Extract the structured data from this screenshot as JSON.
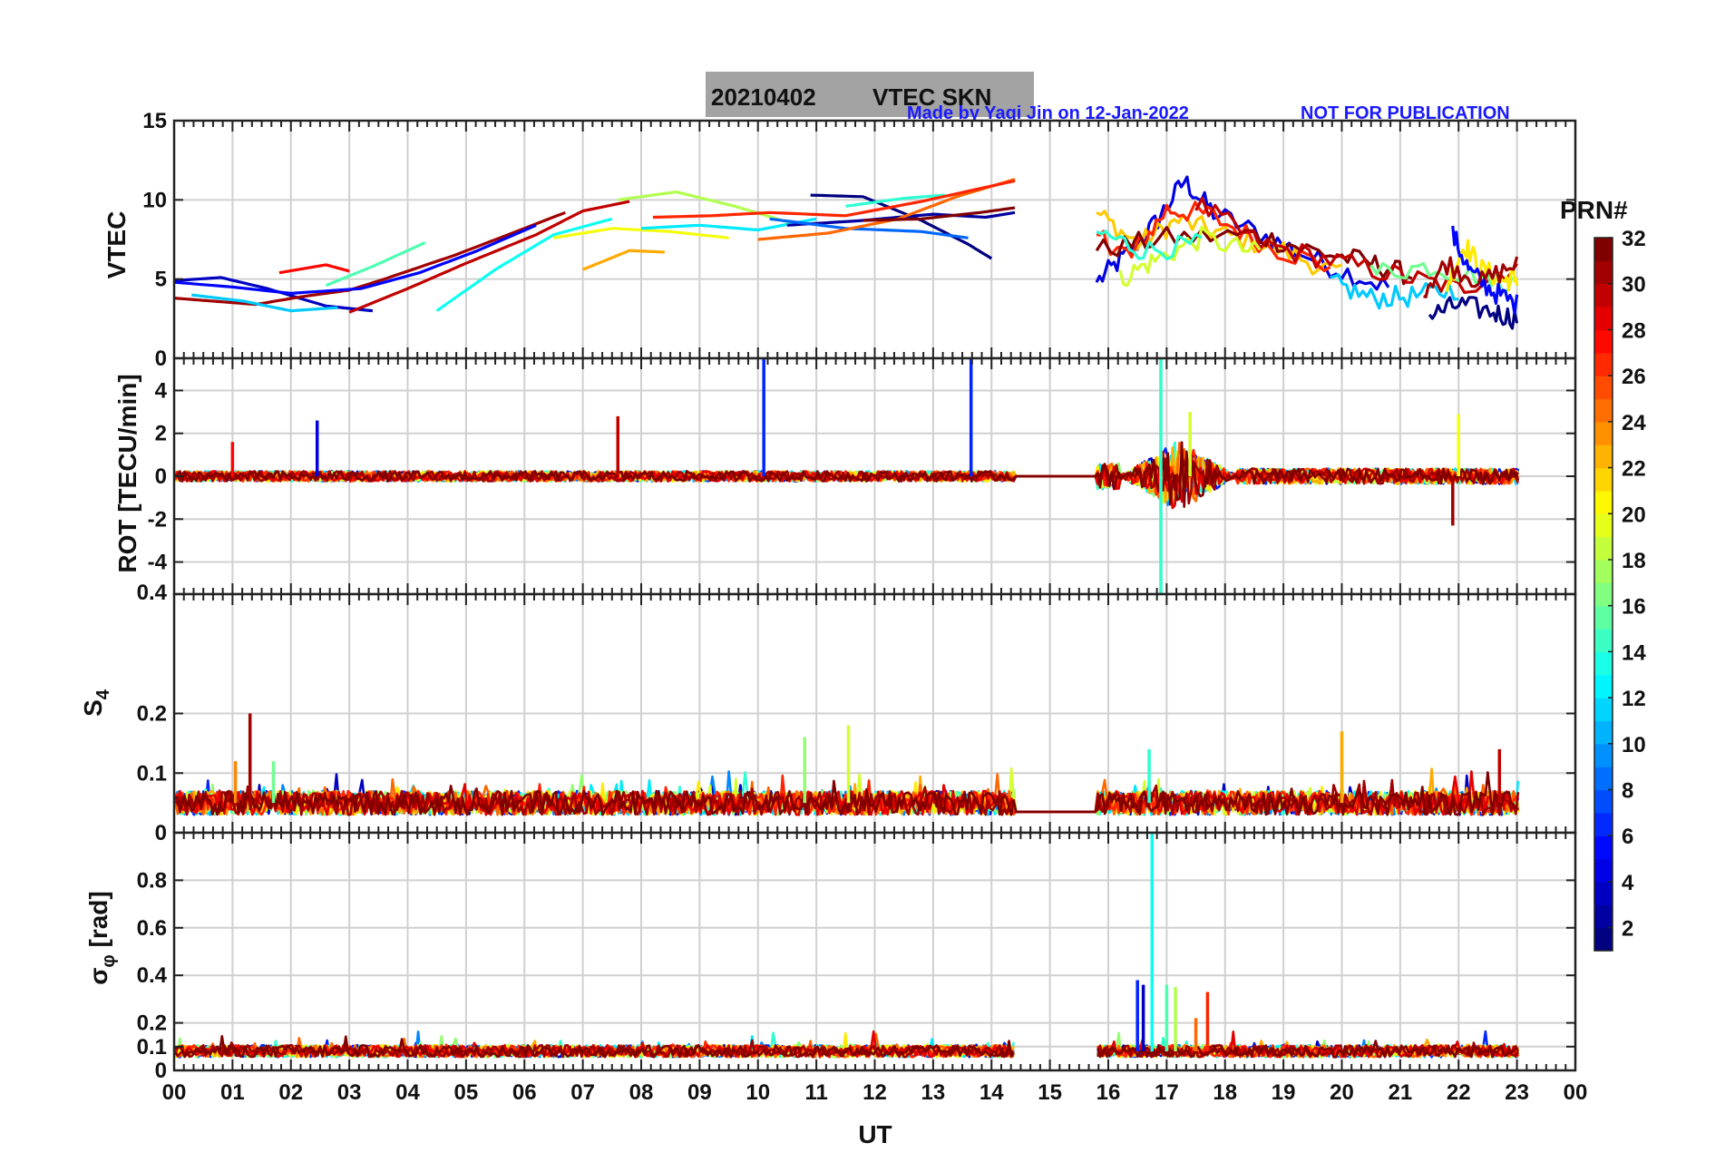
{
  "figure": {
    "title_date": "20210402",
    "title_name": "VTEC  SKN",
    "credit_author": "Made by Yaqi Jin on 12-Jan-2022",
    "credit_notice": "NOT FOR PUBLICATION",
    "xlabel": "UT",
    "colorbar_label": "PRN#"
  },
  "colors": {
    "title_box": "#a3a3a3",
    "credit_text": "#1a1aff",
    "grid": "#d0d0d0",
    "colormap": "jet"
  },
  "colorbar": {
    "min": 1,
    "max": 32,
    "tick_labels": [
      "2",
      "4",
      "6",
      "8",
      "10",
      "12",
      "14",
      "16",
      "18",
      "20",
      "22",
      "24",
      "26",
      "28",
      "30",
      "32"
    ]
  },
  "chart_data": [
    {
      "type": "line",
      "ylabel": "VTEC",
      "ylim": [
        0,
        15
      ],
      "xlim": [
        0,
        24
      ],
      "y_tick_labels": [
        "0",
        "5",
        "10",
        "15"
      ],
      "grid": true,
      "series": [
        {
          "prn": 3,
          "x": [
            0,
            0.8,
            1.6,
            2.6,
            3.4
          ],
          "values": [
            4.9,
            5.1,
            4.4,
            3.3,
            3.0
          ]
        },
        {
          "prn": 31,
          "x": [
            0,
            0.7,
            1.4,
            2.2,
            3.0,
            3.6,
            4.8,
            6.0,
            6.7
          ],
          "values": [
            3.8,
            3.6,
            3.4,
            3.9,
            4.3,
            5.0,
            6.5,
            8.2,
            9.2
          ]
        },
        {
          "prn": 5,
          "x": [
            0,
            1.0,
            2.0,
            3.2,
            4.2,
            5.2,
            6.2
          ],
          "values": [
            4.8,
            4.5,
            4.1,
            4.4,
            5.4,
            6.8,
            8.4
          ]
        },
        {
          "prn": 11,
          "x": [
            0.3,
            1.2,
            2.0,
            2.8
          ],
          "values": [
            4.0,
            3.6,
            3.0,
            3.2
          ]
        },
        {
          "prn": 28,
          "x": [
            1.8,
            2.6,
            3.0
          ],
          "values": [
            5.4,
            5.9,
            5.5
          ]
        },
        {
          "prn": 30,
          "x": [
            3.0,
            4.0,
            5.0,
            6.2,
            7.0,
            7.8
          ],
          "values": [
            2.9,
            4.4,
            6.0,
            7.8,
            9.3,
            9.9
          ]
        },
        {
          "prn": 15,
          "x": [
            2.6,
            3.4,
            4.3
          ],
          "values": [
            4.6,
            5.8,
            7.3
          ]
        },
        {
          "prn": 13,
          "x": [
            4.5,
            5.5,
            6.5,
            7.5
          ],
          "values": [
            3.0,
            5.6,
            7.8,
            8.8
          ]
        },
        {
          "prn": 23,
          "x": [
            7.0,
            7.8,
            8.4
          ],
          "values": [
            5.6,
            6.8,
            6.7
          ]
        },
        {
          "prn": 20,
          "x": [
            6.5,
            7.5,
            8.5,
            9.5
          ],
          "values": [
            7.6,
            8.2,
            8.0,
            7.6
          ]
        },
        {
          "prn": 18,
          "x": [
            7.6,
            8.6,
            9.6,
            10.6
          ],
          "values": [
            10.0,
            10.5,
            9.6,
            8.5
          ]
        },
        {
          "prn": 12,
          "x": [
            8.0,
            9.0,
            10.0,
            11.0
          ],
          "values": [
            8.2,
            8.4,
            8.1,
            8.8
          ]
        },
        {
          "prn": 1,
          "x": [
            10.9,
            11.8,
            12.8,
            13.6,
            14.0
          ],
          "values": [
            10.3,
            10.2,
            8.7,
            7.2,
            6.3
          ]
        },
        {
          "prn": 2,
          "x": [
            10.5,
            11.8,
            13.0,
            13.9,
            14.4
          ],
          "values": [
            8.4,
            8.7,
            9.1,
            8.9,
            9.2
          ]
        },
        {
          "prn": 8,
          "x": [
            10.2,
            11.5,
            12.8,
            13.6
          ],
          "values": [
            8.8,
            8.2,
            8.0,
            7.6
          ]
        },
        {
          "prn": 14,
          "x": [
            11.5,
            12.5,
            13.2
          ],
          "values": [
            9.6,
            10.1,
            10.3
          ]
        },
        {
          "prn": 25,
          "x": [
            10.0,
            11.2,
            12.4,
            13.4,
            14.4
          ],
          "values": [
            7.5,
            7.9,
            8.8,
            10.2,
            11.3
          ]
        },
        {
          "prn": 32,
          "x": [
            11.8,
            12.8,
            13.8,
            14.4
          ],
          "values": [
            8.7,
            8.8,
            9.2,
            9.5
          ]
        },
        {
          "prn": 27,
          "x": [
            8.2,
            9.2,
            10.2,
            11.5,
            12.8,
            14.4
          ],
          "values": [
            8.9,
            9.0,
            9.2,
            9.0,
            9.9,
            11.2
          ]
        },
        {
          "prn": 4,
          "x": [
            15.8,
            16.3,
            16.8,
            17.3,
            17.8,
            18.8,
            19.8,
            20.8
          ],
          "values": [
            4.8,
            6.5,
            8.5,
            11.2,
            9.2,
            7.5,
            5.8,
            4.5
          ]
        },
        {
          "prn": 22,
          "x": [
            15.8,
            16.5,
            17.2,
            18.0,
            19.0,
            20.0
          ],
          "values": [
            9.2,
            7.2,
            8.7,
            7.8,
            6.8,
            5.2
          ]
        },
        {
          "prn": 27,
          "x": [
            15.8,
            16.4,
            17.0,
            17.7,
            18.8,
            19.8
          ],
          "values": [
            7.8,
            6.4,
            9.4,
            9.1,
            7.0,
            5.8
          ]
        },
        {
          "prn": 32,
          "x": [
            15.8,
            17.0,
            18.5,
            19.5,
            20.5,
            21.2
          ],
          "values": [
            6.8,
            7.6,
            7.8,
            6.8,
            6.0,
            5.2
          ]
        },
        {
          "prn": 30,
          "x": [
            17.5,
            18.6,
            19.8,
            21.0,
            22.0,
            23.0
          ],
          "values": [
            9.8,
            7.2,
            6.2,
            5.2,
            4.4,
            5.8
          ]
        },
        {
          "prn": 19,
          "x": [
            16.2,
            16.8,
            17.6,
            18.6
          ],
          "values": [
            5.0,
            6.2,
            7.6,
            6.6
          ]
        },
        {
          "prn": 14,
          "x": [
            15.8,
            16.6,
            17.6
          ],
          "values": [
            8.0,
            6.8,
            7.2
          ]
        },
        {
          "prn": 11,
          "x": [
            19.8,
            20.5,
            21.2,
            22.0
          ],
          "values": [
            4.8,
            3.8,
            3.9,
            4.4
          ]
        },
        {
          "prn": 16,
          "x": [
            20.5,
            21.5,
            22.5,
            23.0
          ],
          "values": [
            5.4,
            5.8,
            5.1,
            4.6
          ]
        },
        {
          "prn": 21,
          "x": [
            21.8,
            22.1,
            22.4,
            22.8,
            23.0
          ],
          "values": [
            4.6,
            7.2,
            5.6,
            4.9,
            5.1
          ]
        },
        {
          "prn": 1,
          "x": [
            21.5,
            22.0,
            22.6,
            23.0
          ],
          "values": [
            2.7,
            3.4,
            2.9,
            2.5
          ]
        },
        {
          "prn": 5,
          "x": [
            21.9,
            22.2,
            22.6,
            23.0
          ],
          "values": [
            7.8,
            5.4,
            4.2,
            3.4
          ]
        },
        {
          "prn": 31,
          "x": [
            21.4,
            21.8,
            22.4,
            23.0
          ],
          "values": [
            4.4,
            6.0,
            4.8,
            6.0
          ]
        }
      ]
    },
    {
      "type": "line",
      "ylabel": "ROT [TECU/min]",
      "ylim": [
        -5.5,
        5.5
      ],
      "xlim": [
        0,
        24
      ],
      "y_tick_labels": [
        "-4",
        "-2",
        "0",
        "2",
        "4"
      ],
      "grid": true,
      "data_gap": [
        14.4,
        15.8
      ],
      "spikes": [
        {
          "prn": 4,
          "x": 2.45,
          "y": 2.6
        },
        {
          "prn": 30,
          "x": 7.6,
          "y": 2.8
        },
        {
          "prn": 6,
          "x": 10.1,
          "y": 5.5
        },
        {
          "prn": 6,
          "x": 13.65,
          "y": 5.5
        },
        {
          "prn": 14,
          "x": 16.9,
          "y": 5.5
        },
        {
          "prn": 14,
          "x": 16.9,
          "y": -5.5
        },
        {
          "prn": 28,
          "x": 1.0,
          "y": 1.6
        },
        {
          "prn": 19,
          "x": 17.4,
          "y": 3.0
        },
        {
          "prn": 20,
          "x": 22.0,
          "y": 2.9
        },
        {
          "prn": 31,
          "x": 21.9,
          "y": -2.3
        }
      ],
      "noise_amplitude_before_gap": 0.4,
      "noise_amplitude_disturbed_16_18UT": 2.8,
      "noise_amplitude_after_19UT": 0.6
    },
    {
      "type": "line",
      "ylabel": "S4",
      "ylim": [
        0,
        0.4
      ],
      "xlim": [
        0,
        24
      ],
      "y_tick_labels": [
        "0",
        "0.1",
        "0.2",
        "0.4"
      ],
      "grid": true,
      "baseline": 0.05,
      "spikes": [
        {
          "prn": 31,
          "x": 1.3,
          "y": 0.2
        },
        {
          "prn": 24,
          "x": 1.05,
          "y": 0.12
        },
        {
          "prn": 16,
          "x": 1.7,
          "y": 0.12
        },
        {
          "prn": 17,
          "x": 10.8,
          "y": 0.16
        },
        {
          "prn": 19,
          "x": 11.55,
          "y": 0.18
        },
        {
          "prn": 14,
          "x": 16.7,
          "y": 0.14
        },
        {
          "prn": 23,
          "x": 20.0,
          "y": 0.17
        },
        {
          "prn": 30,
          "x": 22.7,
          "y": 0.14
        }
      ]
    },
    {
      "type": "line",
      "ylabel": "σ_φ [rad]",
      "ylim": [
        0,
        1
      ],
      "xlim": [
        0,
        24
      ],
      "y_tick_labels": [
        "0",
        "0.1",
        "0.2",
        "0.4",
        "0.6",
        "0.8"
      ],
      "grid": true,
      "baseline": 0.08,
      "data_gap": [
        14.4,
        15.8
      ],
      "spikes": [
        {
          "prn": 13,
          "x": 16.75,
          "y": 1.0
        },
        {
          "prn": 6,
          "x": 16.5,
          "y": 0.38
        },
        {
          "prn": 3,
          "x": 16.6,
          "y": 0.36
        },
        {
          "prn": 15,
          "x": 17.0,
          "y": 0.36
        },
        {
          "prn": 18,
          "x": 17.15,
          "y": 0.35
        },
        {
          "prn": 27,
          "x": 17.7,
          "y": 0.33
        },
        {
          "prn": 25,
          "x": 17.5,
          "y": 0.22
        }
      ]
    }
  ],
  "x_tick_labels": [
    "00",
    "01",
    "02",
    "03",
    "04",
    "05",
    "06",
    "07",
    "08",
    "09",
    "10",
    "11",
    "12",
    "13",
    "14",
    "15",
    "16",
    "17",
    "18",
    "19",
    "20",
    "21",
    "22",
    "23",
    "00"
  ]
}
